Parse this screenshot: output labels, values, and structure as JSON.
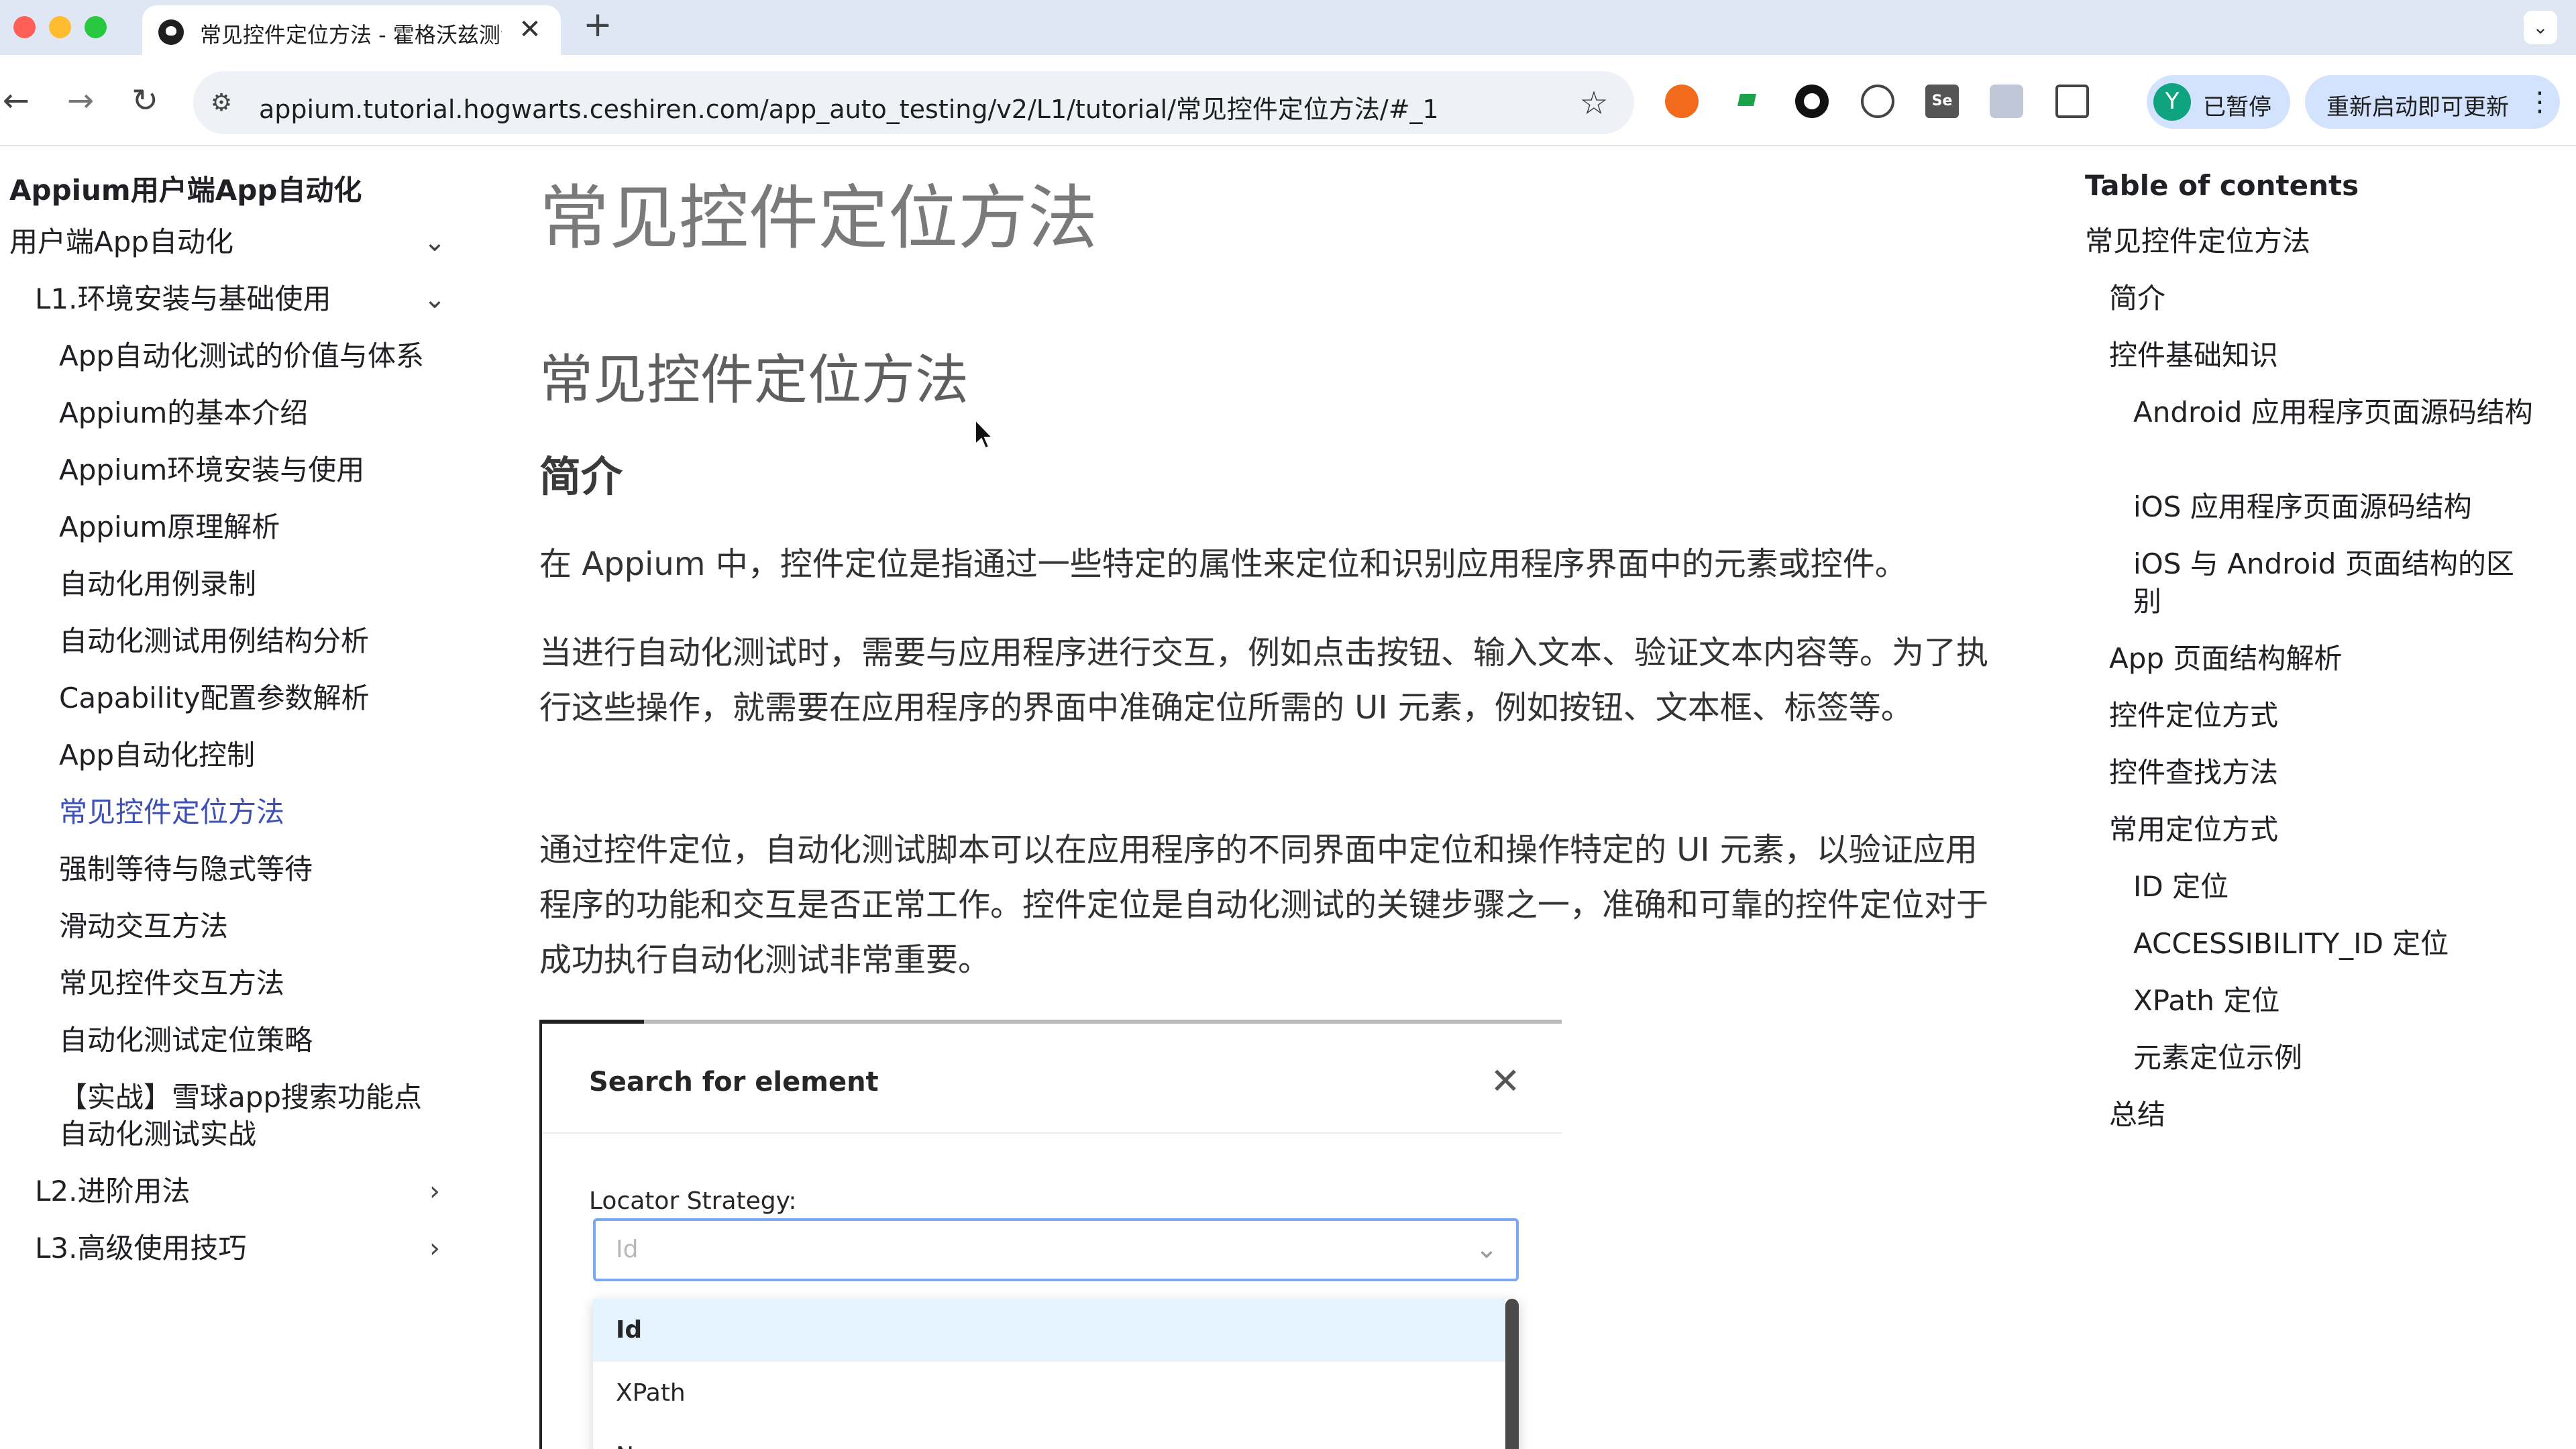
{
  "browser": {
    "tab_title": "常见控件定位方法 - 霍格沃兹测试开发学社",
    "tab_close": "✕",
    "new_tab": "+",
    "tab_search": "⌄",
    "back": "←",
    "forward": "→",
    "reload": "↻",
    "site_info": "⚙",
    "url": "appium.tutorial.hogwarts.ceshiren.com/app_auto_testing/v2/L1/tutorial/常见控件定位方法/#_1",
    "bookmark": "☆",
    "profile_initial": "Y",
    "profile_status": "已暂停",
    "update_label": "重新启动即可更新",
    "update_menu": "⋮",
    "extension_se_label": "Se"
  },
  "sidebar": {
    "site_title": "Appium用户端App自动化",
    "section": "用户端App自动化",
    "section_chevron": "⌄",
    "level1": "L1.环境安装与基础使用",
    "level1_chevron": "⌄",
    "items": [
      "App自动化测试的价值与体系",
      "Appium的基本介绍",
      "Appium环境安装与使用",
      "Appium原理解析",
      "自动化用例录制",
      "自动化测试用例结构分析",
      "Capability配置参数解析",
      "App自动化控制",
      "常见控件定位方法",
      "强制等待与隐式等待",
      "滑动交互方法",
      "常见控件交互方法",
      "自动化测试定位策略",
      "【实战】雪球app搜索功能点",
      "自动化测试实战"
    ],
    "active_item": "常见控件定位方法",
    "level2": "L2.进阶用法",
    "level2_chevron": "›",
    "level3": "L3.高级使用技巧",
    "level3_chevron": "›"
  },
  "content": {
    "page_title": "常见控件定位方法",
    "section_title": "常见控件定位方法",
    "intro_heading": "简介",
    "paragraphs": [
      "在 Appium 中，控件定位是指通过一些特定的属性来定位和识别应用程序界面中的元素或控件。",
      "当进行自动化测试时，需要与应用程序进行交互，例如点击按钮、输入文本、验证文本内容等。为了执行这些操作，就需要在应用程序的界面中准确定位所需的 UI 元素，例如按钮、文本框、标签等。",
      "通过控件定位，自动化测试脚本可以在应用程序的不同界面中定位和操作特定的 UI 元素，以验证应用程序的功能和交互是否正常工作。控件定位是自动化测试的关键步骤之一，准确和可靠的控件定位对于成功执行自动化测试非常重要。"
    ]
  },
  "dialog": {
    "title": "Search for element",
    "close": "✕",
    "locator_label": "Locator Strategy:",
    "locator_value": "Id",
    "select_chevron": "⌄",
    "options": [
      "Id",
      "XPath",
      "Name"
    ],
    "selected_option": "Id"
  },
  "toc": {
    "title": "Table of contents",
    "items": [
      "常见控件定位方法",
      "简介",
      "控件基础知识",
      "Android 应用程序页面源码结构",
      "iOS 应用程序页面源码结构",
      "iOS 与 Android 页面结构的区别",
      "App 页面结构解析",
      "控件定位方式",
      "控件查找方法",
      "常用定位方式",
      "ID 定位",
      "ACCESSIBILITY_ID 定位",
      "XPath 定位",
      "元素定位示例",
      "总结"
    ]
  }
}
